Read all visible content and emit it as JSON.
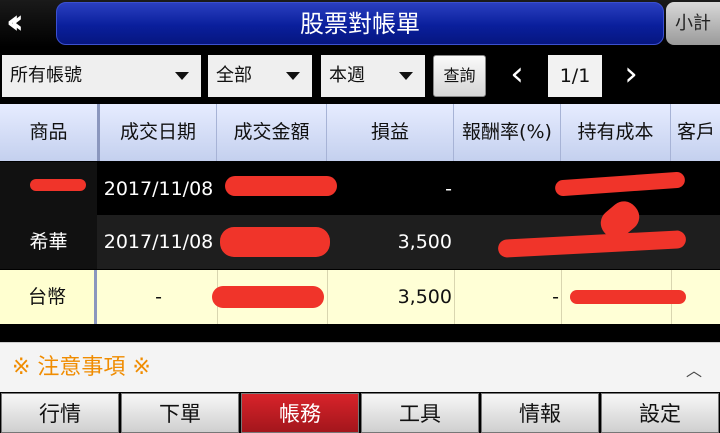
{
  "header": {
    "back_icon": "double-chevron-left-icon",
    "title": "股票對帳單",
    "subtotal_label": "小計"
  },
  "filters": {
    "account": "所有帳號",
    "scope": "全部",
    "period": "本週",
    "query_label": "查詢",
    "page": "1/1",
    "prev_icon": "chevron-left-icon",
    "next_icon": "chevron-right-icon"
  },
  "table": {
    "columns": [
      "商品",
      "成交日期",
      "成交金額",
      "損益",
      "報酬率(%)",
      "持有成本",
      "客戶"
    ],
    "rows": [
      {
        "product": "",
        "date": "2017/11/08",
        "profit": "-"
      },
      {
        "product": "希華",
        "date": "2017/11/08",
        "profit": "3,500"
      },
      {
        "product": "台幣",
        "date": "-",
        "profit": "3,500"
      }
    ]
  },
  "notice": {
    "label": "※ 注意事項 ※"
  },
  "tabs": [
    "行情",
    "下單",
    "帳務",
    "工具",
    "情報",
    "設定"
  ],
  "active_tab": "帳務",
  "colors": {
    "title_bar": "#0a1f9c",
    "active_tab": "#c81e25",
    "notice_text": "#f08c00",
    "redaction": "#f0342a"
  }
}
